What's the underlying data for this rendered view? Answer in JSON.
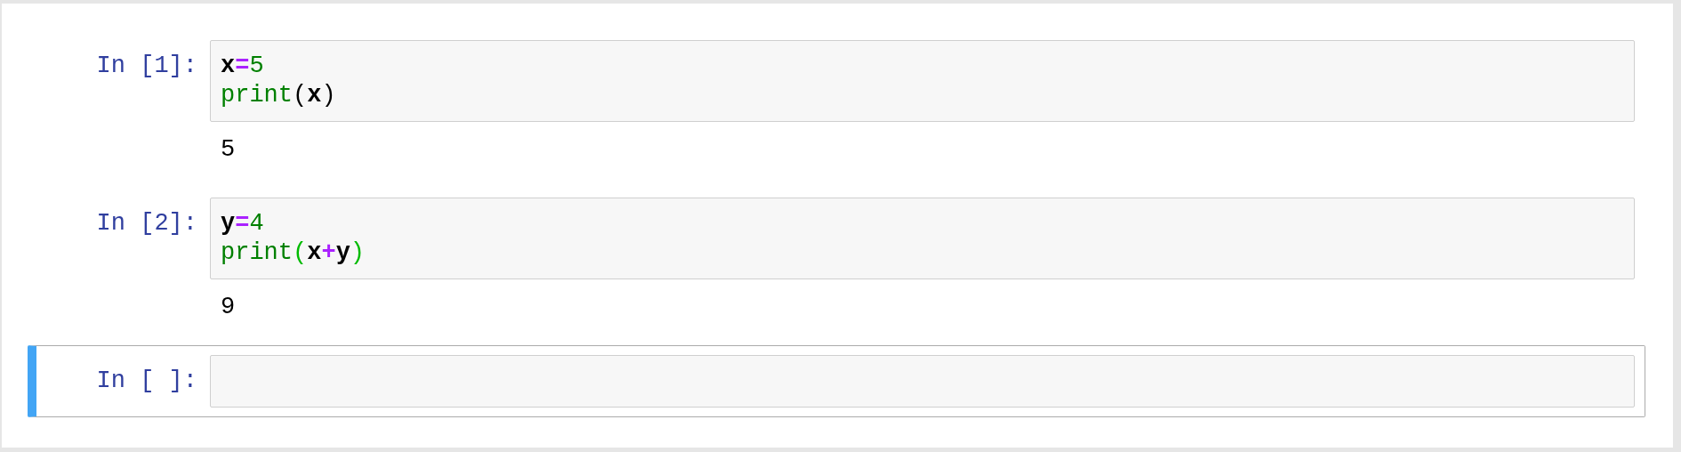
{
  "cells": [
    {
      "prompt": "In [1]:",
      "selected": false,
      "lines": [
        [
          {
            "text": "x",
            "kind": "variable"
          },
          {
            "text": "=",
            "kind": "operator"
          },
          {
            "text": "5",
            "kind": "number"
          }
        ],
        [
          {
            "text": "print",
            "kind": "builtin"
          },
          {
            "text": "(",
            "kind": "punctuation"
          },
          {
            "text": "x",
            "kind": "variable"
          },
          {
            "text": ")",
            "kind": "punctuation"
          }
        ]
      ],
      "output": "5"
    },
    {
      "prompt": "In [2]:",
      "selected": false,
      "lines": [
        [
          {
            "text": "y",
            "kind": "variable"
          },
          {
            "text": "=",
            "kind": "operator"
          },
          {
            "text": "4",
            "kind": "number"
          }
        ],
        [
          {
            "text": "print",
            "kind": "builtin"
          },
          {
            "text": "(",
            "kind": "matched-bracket"
          },
          {
            "text": "x",
            "kind": "variable"
          },
          {
            "text": "+",
            "kind": "operator"
          },
          {
            "text": "y",
            "kind": "variable"
          },
          {
            "text": ")",
            "kind": "matched-bracket"
          }
        ]
      ],
      "output": "9"
    },
    {
      "prompt": "In [ ]:",
      "selected": true
    }
  ]
}
